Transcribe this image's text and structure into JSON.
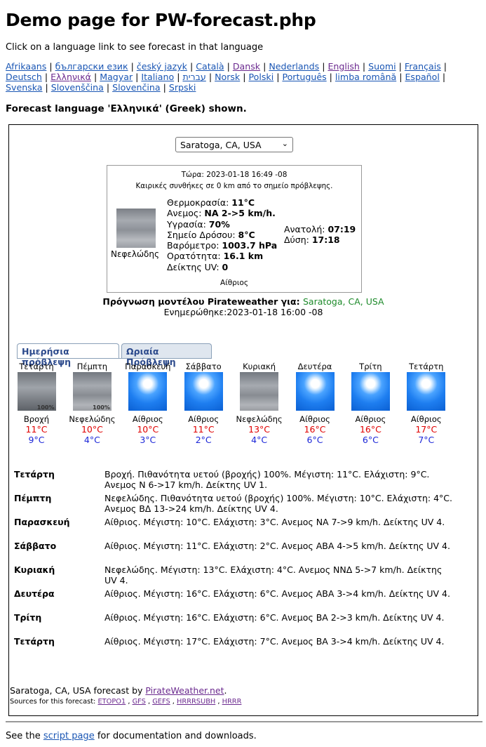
{
  "page": {
    "title": "Demo page for PW-forecast.php",
    "intro": "Click on a language link to see forecast in that language",
    "shown": "Forecast language 'Ελληνικά' (Greek) shown."
  },
  "languages": [
    "Afrikaans",
    "български език",
    "český jazyk",
    "Català",
    "Dansk",
    "Nederlands",
    "English",
    "Suomi",
    "Français",
    "Deutsch",
    "Ελληνικά",
    "Magyar",
    "Italiano",
    "עברית",
    "Norsk",
    "Polski",
    "Português",
    "limba română",
    "Español",
    "Svenska",
    "Slovenščina",
    "Slovenčina",
    "Srpski"
  ],
  "location_select": {
    "value": "Saratoga, CA, USA"
  },
  "current": {
    "now": "Τώρα: 2023-01-18 16:49 -08",
    "subtitle": "Καιρικές συνθήκες σε 0 km από το σημείο πρόβλεψης.",
    "image_label": "Νεφελώδης",
    "rows": [
      {
        "label": "Θερμοκρασία: ",
        "value": "11°C"
      },
      {
        "label": "Ανεμος: ",
        "value": "NA 2->5 km/h."
      },
      {
        "label": "Υγρασία: ",
        "value": "70%"
      },
      {
        "label": "Σημείο Δρόσου: ",
        "value": "8°C"
      },
      {
        "label": "Βαρόμετρο: ",
        "value": "1003.7 hPa"
      },
      {
        "label": "Ορατότητα: ",
        "value": "16.1 km"
      },
      {
        "label": "Δείκτης UV: ",
        "value": "0"
      }
    ],
    "sunrise_label": "Ανατολή: ",
    "sunrise": "07:19",
    "sunset_label": "Δύση: ",
    "sunset": "17:18",
    "condition": "Αίθριος"
  },
  "forecast_for": {
    "label": "Πρόγνωση μοντέλου Pirateweather για: ",
    "location": "Saratoga, CA, USA"
  },
  "updated": "Ενημερώθηκε:2023-01-18 16:00 -08",
  "tabs": [
    "Ημερήσια πρόβλεψη",
    "Ωριαία Πρόβλεψη"
  ],
  "days": [
    {
      "name": "Τετάρτη",
      "icon": "rain-icon",
      "pct": "100%",
      "cond": "Βροχή",
      "hi": "11°C",
      "lo": "9°C"
    },
    {
      "name": "Πέμπτη",
      "icon": "cloudy-icon",
      "pct": "100%",
      "cond": "Νεφελώδης",
      "hi": "10°C",
      "lo": "4°C"
    },
    {
      "name": "Παρασκευή",
      "icon": "sunny-icon",
      "pct": "",
      "cond": "Αίθριος",
      "hi": "10°C",
      "lo": "3°C"
    },
    {
      "name": "Σάββατο",
      "icon": "sunny-icon",
      "pct": "",
      "cond": "Αίθριος",
      "hi": "11°C",
      "lo": "2°C"
    },
    {
      "name": "Κυριακή",
      "icon": "cloudy-icon",
      "pct": "",
      "cond": "Νεφελώδης",
      "hi": "13°C",
      "lo": "4°C"
    },
    {
      "name": "Δευτέρα",
      "icon": "sunny-icon",
      "pct": "",
      "cond": "Αίθριος",
      "hi": "16°C",
      "lo": "6°C"
    },
    {
      "name": "Τρίτη",
      "icon": "sunny-icon",
      "pct": "",
      "cond": "Αίθριος",
      "hi": "16°C",
      "lo": "6°C"
    },
    {
      "name": "Τετάρτη",
      "icon": "sunny-icon",
      "pct": "",
      "cond": "Αίθριος",
      "hi": "17°C",
      "lo": "7°C"
    }
  ],
  "details": [
    {
      "name": "Τετάρτη",
      "text": "Βροχή. Πιθανότητα υετού (βροχής) 100%. Μέγιστη: 11°C. Ελάχιστη: 9°C. Ανεμος N 6->17 km/h. Δείκτης UV 1."
    },
    {
      "name": "Πέμπτη",
      "text": "Νεφελώδης. Πιθανότητα υετού (βροχής) 100%. Μέγιστη: 10°C. Ελάχιστη: 4°C. Ανεμος ΒΔ 13->24 km/h. Δείκτης UV 4."
    },
    {
      "name": "Παρασκευή",
      "text": "Αίθριος. Μέγιστη: 10°C. Ελάχιστη: 3°C. Ανεμος NA 7->9 km/h. Δείκτης UV 4."
    },
    {
      "name": "Σάββατο",
      "text": "Αίθριος. Μέγιστη: 11°C. Ελάχιστη: 2°C. Ανεμος ABA 4->5 km/h. Δείκτης UV 4."
    },
    {
      "name": "Κυριακή",
      "text": "Νεφελώδης. Μέγιστη: 13°C. Ελάχιστη: 4°C. Ανεμος NNΔ 5->7 km/h. Δείκτης UV 4."
    },
    {
      "name": "Δευτέρα",
      "text": "Αίθριος. Μέγιστη: 16°C. Ελάχιστη: 6°C. Ανεμος ABA 3->4 km/h. Δείκτης UV 4."
    },
    {
      "name": "Τρίτη",
      "text": "Αίθριος. Μέγιστη: 16°C. Ελάχιστη: 6°C. Ανεμος BA 2->3 km/h. Δείκτης UV 4."
    },
    {
      "name": "Τετάρτη",
      "text": "Αίθριος. Μέγιστη: 17°C. Ελάχιστη: 7°C. Ανεμος BA 3->4 km/h. Δείκτης UV 4."
    }
  ],
  "credit": {
    "prefix": "Saratoga, CA, USA forecast by ",
    "link": "PirateWeather.net",
    "suffix": "."
  },
  "sources": {
    "prefix": "Sources for this forecast: ",
    "items": [
      "ETOPO1",
      "GFS",
      "GEFS",
      "HRRRSUBH",
      "HRRR"
    ]
  },
  "footer": {
    "prefix": "See the ",
    "link": "script page",
    "suffix": " for documentation and downloads."
  }
}
